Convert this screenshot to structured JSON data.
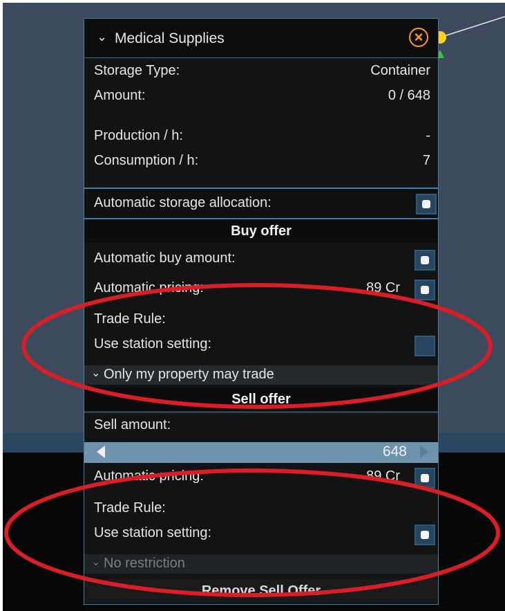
{
  "panel": {
    "title": "Medical Supplies",
    "close_icon": "close-icon",
    "chevron_icon": "chevron-down-icon",
    "info": [
      {
        "label": "Storage Type:",
        "value": "Container"
      },
      {
        "label": "Amount:",
        "value": "0 / 648"
      },
      {
        "label": "Production / h:",
        "value": "-"
      },
      {
        "label": "Consumption / h:",
        "value": "7"
      }
    ],
    "auto_alloc": {
      "label": "Automatic storage allocation:",
      "checked": true
    }
  },
  "buy": {
    "title": "Buy offer",
    "auto_amount": {
      "label": "Automatic buy amount:",
      "checked": true
    },
    "auto_pricing": {
      "label": "Automatic pricing:",
      "price": "89 Cr",
      "checked": true
    },
    "trade_rule_label": "Trade Rule:",
    "use_station": {
      "label": "Use station setting:",
      "checked": false
    },
    "rule_option": "Only my property may trade"
  },
  "sell": {
    "title": "Sell offer",
    "amount_label": "Sell amount:",
    "amount_value": "648",
    "auto_pricing": {
      "label": "Automatic pricing:",
      "price": "89 Cr",
      "checked": true
    },
    "trade_rule_label": "Trade Rule:",
    "use_station": {
      "label": "Use station setting:",
      "checked": true
    },
    "rule_option": "No restriction",
    "remove_label": "Remove Sell Offer"
  },
  "colors": {
    "accent": "#4c7ea0",
    "close": "#ff9a1a",
    "annotation": "#d81f26",
    "node": "#ffd21a"
  }
}
